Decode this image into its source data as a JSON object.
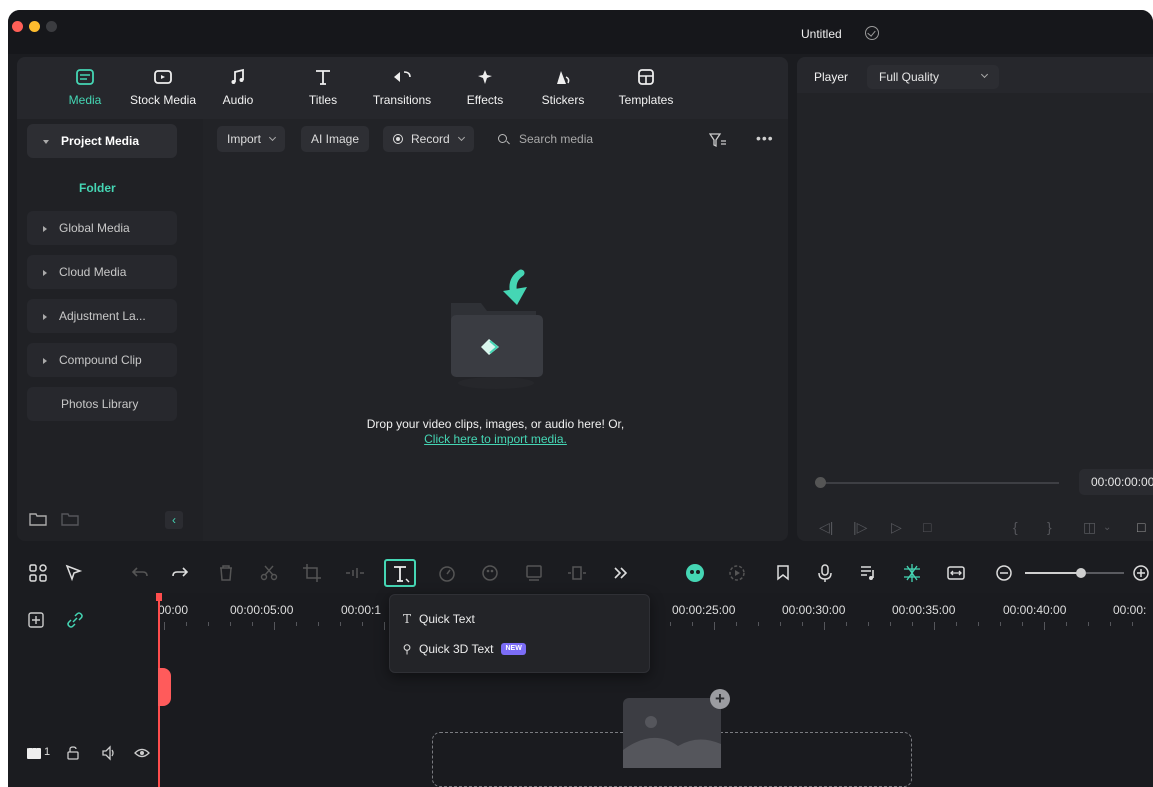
{
  "window": {
    "project_title": "Untitled"
  },
  "tabs": [
    {
      "label": "Media",
      "icon": "media-icon",
      "active": true
    },
    {
      "label": "Stock Media",
      "icon": "stock-media-icon"
    },
    {
      "label": "Audio",
      "icon": "audio-icon"
    },
    {
      "label": "Titles",
      "icon": "titles-icon"
    },
    {
      "label": "Transitions",
      "icon": "transitions-icon"
    },
    {
      "label": "Effects",
      "icon": "effects-icon"
    },
    {
      "label": "Stickers",
      "icon": "stickers-icon"
    },
    {
      "label": "Templates",
      "icon": "templates-icon"
    }
  ],
  "sidebar": {
    "project_media": "Project Media",
    "folder": "Folder",
    "items": [
      "Global Media",
      "Cloud Media",
      "Adjustment La...",
      "Compound Clip",
      "Photos Library"
    ]
  },
  "media_toolbar": {
    "import": "Import",
    "ai_image": "AI Image",
    "record": "Record",
    "search_placeholder": "Search media"
  },
  "drop_area": {
    "text": "Drop your video clips, images, or audio here! Or,",
    "link": "Click here to import media."
  },
  "player": {
    "label": "Player",
    "quality": "Full Quality",
    "timecode": "00:00:00:00"
  },
  "timeline": {
    "ruler": [
      "00:00",
      "00:00:05:00",
      "00:00:1",
      "00:00:25:00",
      "00:00:30:00",
      "00:00:35:00",
      "00:00:40:00",
      "00:00:"
    ],
    "track_number": "1"
  },
  "text_menu": {
    "items": [
      {
        "label": "Quick Text",
        "icon": "text-icon"
      },
      {
        "label": "Quick 3D Text",
        "icon": "3d-text-icon",
        "badge": "NEW"
      }
    ]
  },
  "colors": {
    "accent": "#45d6b4",
    "playhead": "#ff4d4d",
    "new_badge": "#7b6cf6"
  }
}
